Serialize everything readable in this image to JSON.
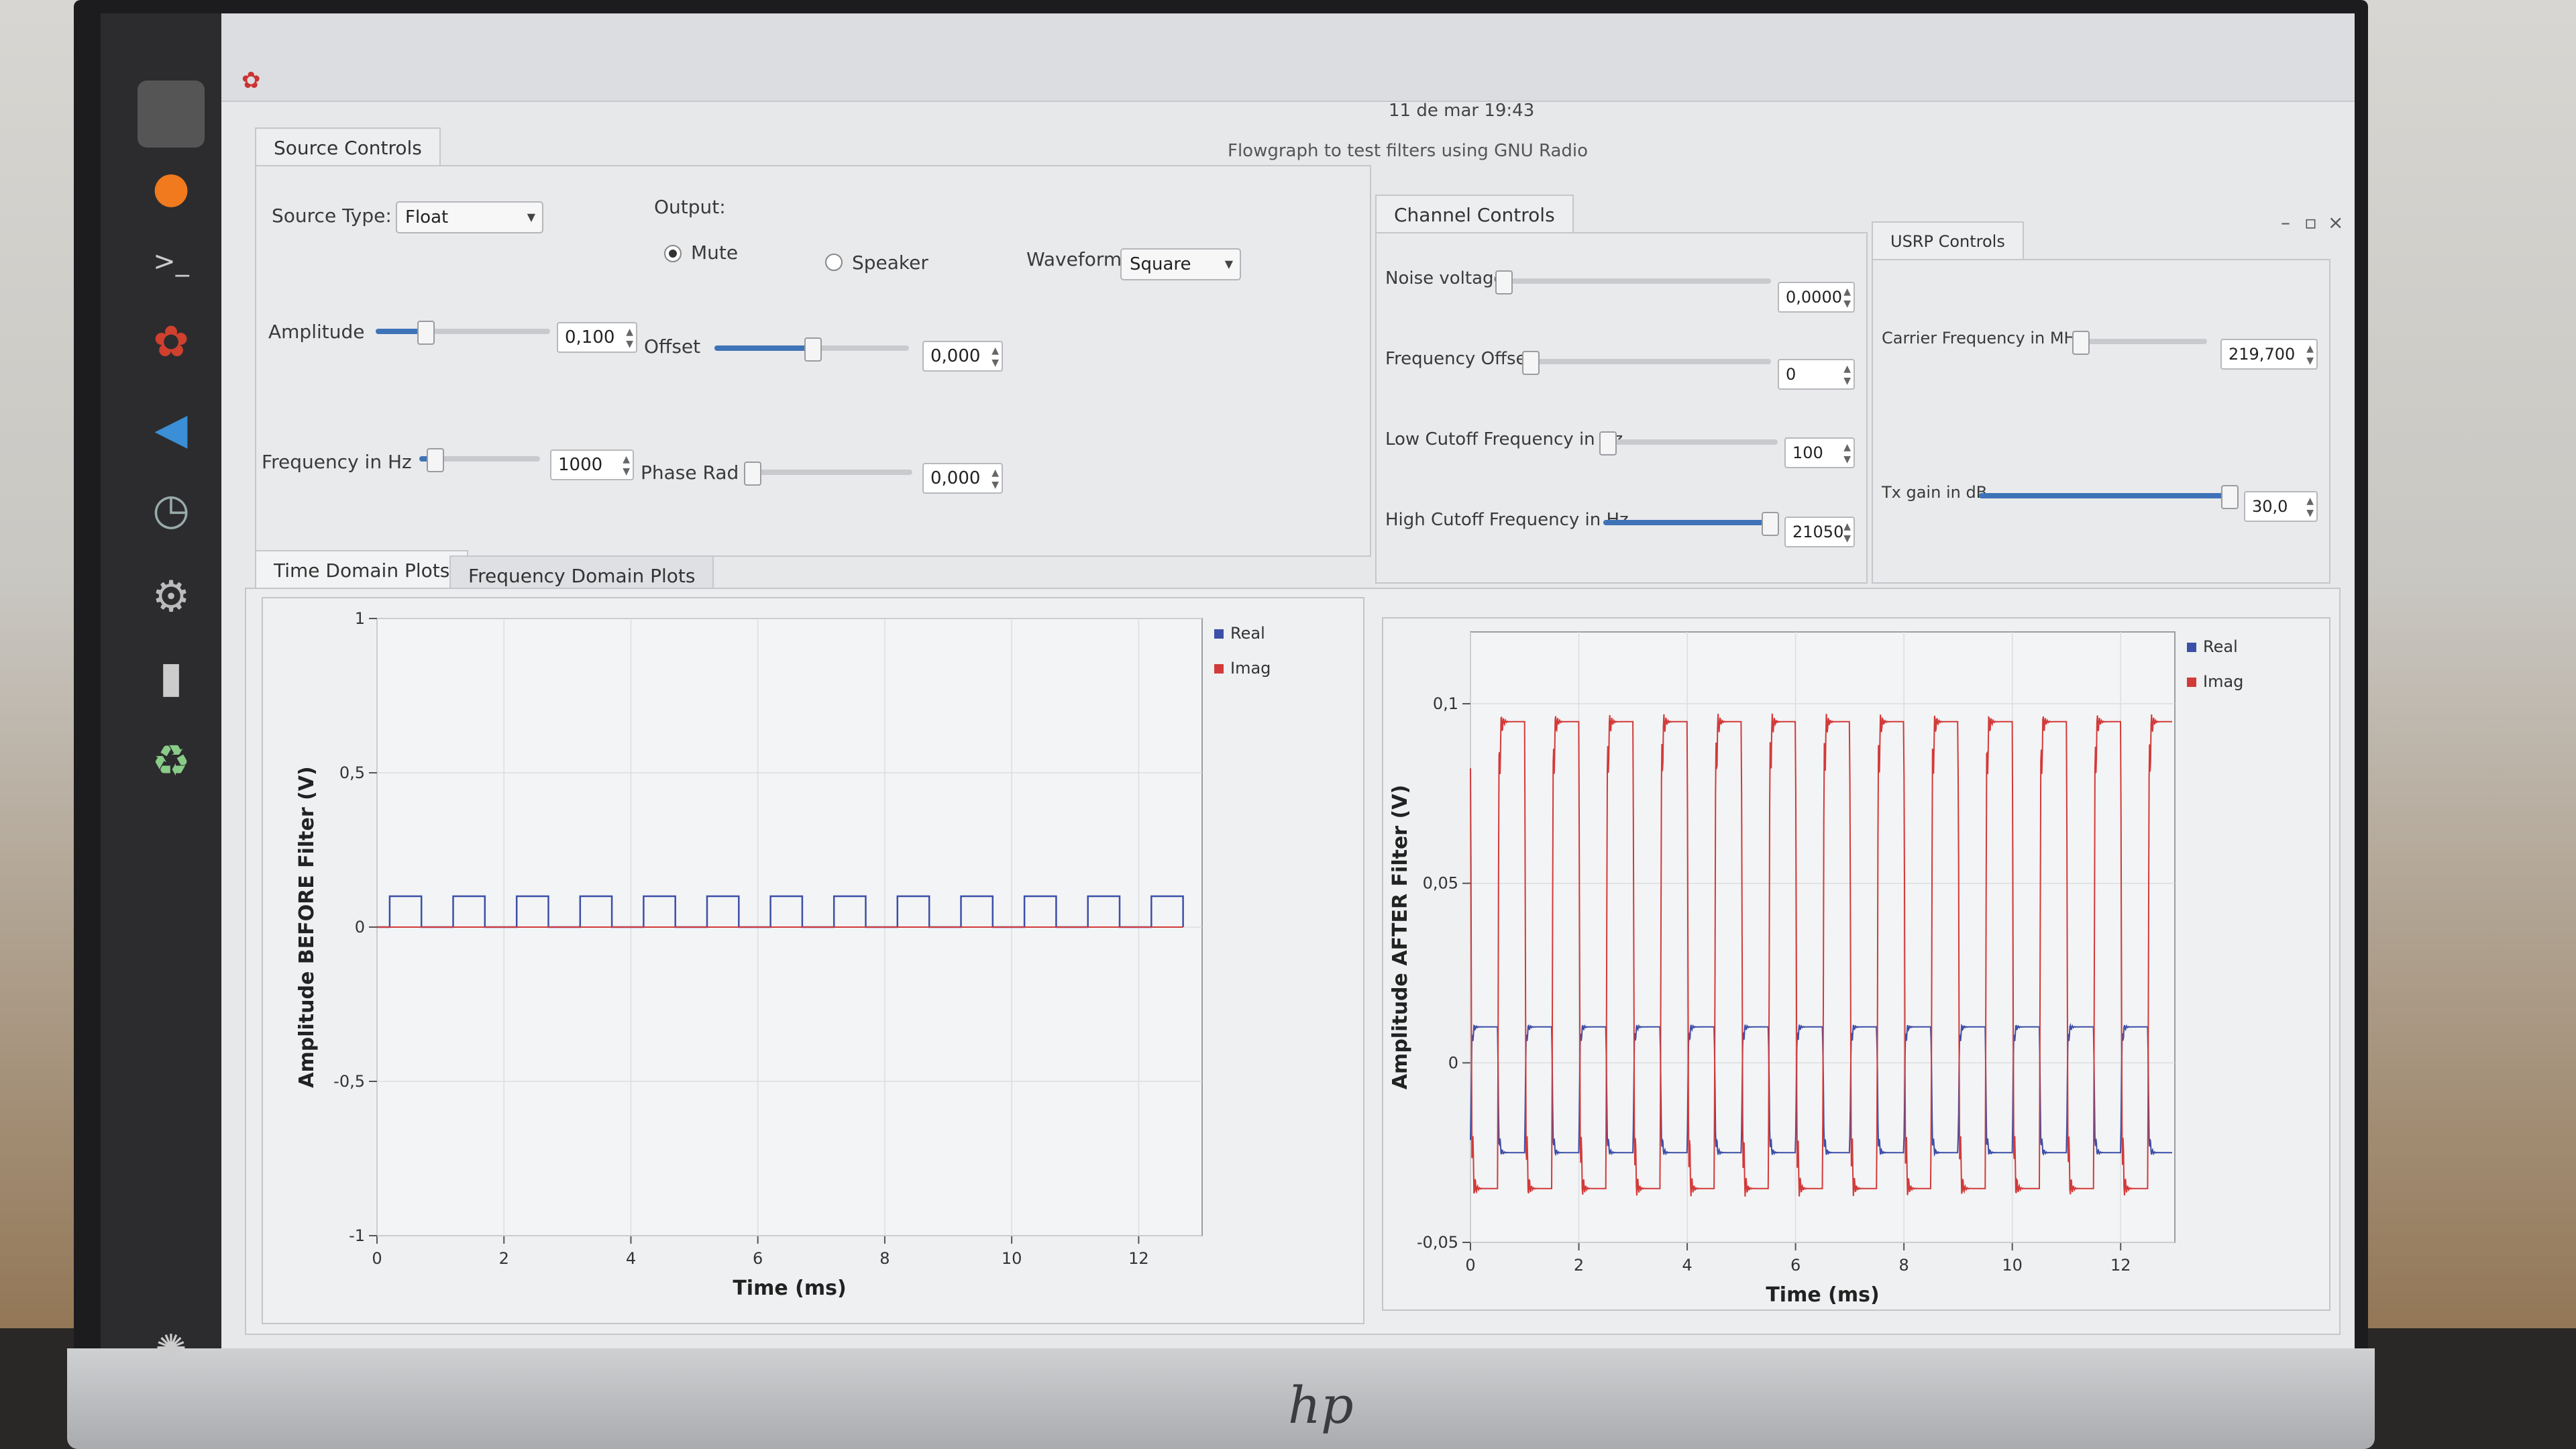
{
  "window": {
    "clock": "11 de mar 19:43",
    "title": "Flowgraph to test filters using GNU Radio",
    "minimize": "–",
    "maximize": "▫",
    "close": "×"
  },
  "source_controls": {
    "tab": "Source Controls",
    "source_type_label": "Source Type:",
    "source_type_value": "Float",
    "output_label": "Output:",
    "mute_label": "Mute",
    "speaker_label": "Speaker",
    "output_selected": "Mute",
    "waveform_label": "Waveform:",
    "waveform_value": "Square",
    "amplitude_label": "Amplitude",
    "amplitude_value": "0,100",
    "amplitude_level": 0.28,
    "offset_label": "Offset",
    "offset_value": "0,000",
    "offset_level": 0.5,
    "frequency_label": "Frequency in Hz",
    "frequency_value": "1000",
    "frequency_level": 0.12,
    "phase_label": "Phase Rad",
    "phase_value": "0,000",
    "phase_level": 0.0
  },
  "channel_controls": {
    "tab": "Channel Controls",
    "noise_label": "Noise voltage",
    "noise_value": "0,0000",
    "noise_level": 0.0,
    "freq_offset_label": "Frequency Offset",
    "freq_offset_value": "0",
    "freq_offset_level": 0.0,
    "low_cutoff_label": "Low Cutoff Frequency in Hz",
    "low_cutoff_value": "100",
    "low_cutoff_level": 0.02,
    "high_cutoff_label": "High Cutoff Frequency in Hz",
    "high_cutoff_value": "21050",
    "high_cutoff_level": 0.95
  },
  "usrp_controls": {
    "tab": "USRP Controls",
    "carrier_label": "Carrier Frequency in MHz",
    "carrier_value": "219,700",
    "carrier_level": 0.05,
    "gain_label": "Tx gain in dB",
    "gain_value": "30,0",
    "gain_level": 0.98
  },
  "plot_tabs": {
    "time_domain": "Time Domain Plots",
    "frequency_domain": "Frequency Domain Plots",
    "active": "Time Domain Plots"
  },
  "colors": {
    "real": "#3c4fa8",
    "imag": "#d23a3a",
    "accent": "#3f73b8"
  },
  "chart_data": [
    {
      "type": "line",
      "ylabel": "Amplitude BEFORE Filter (V)",
      "xlabel": "Time (ms)",
      "xlim": [
        0,
        13
      ],
      "ylim": [
        -1,
        1
      ],
      "xticks": [
        0,
        2,
        4,
        6,
        8,
        10,
        12
      ],
      "yticks": [
        {
          "v": 1,
          "t": "1"
        },
        {
          "v": 0.5,
          "t": "0,5"
        },
        {
          "v": 0,
          "t": "0"
        },
        {
          "v": -0.5,
          "t": "-0,5"
        },
        {
          "v": -1,
          "t": "-1"
        }
      ],
      "legend": "top-right",
      "series": [
        {
          "name": "Real",
          "kind": "square",
          "period": 1.0,
          "low": 0,
          "high": 0.1,
          "duty": 0.5,
          "start": 0.2
        },
        {
          "name": "Imag",
          "kind": "constant",
          "value": 0
        }
      ]
    },
    {
      "type": "line",
      "ylabel": "Amplitude AFTER Filter (V)",
      "xlabel": "Time (ms)",
      "xlim": [
        0,
        13
      ],
      "ylim": [
        -0.05,
        0.12
      ],
      "xticks": [
        0,
        2,
        4,
        6,
        8,
        10,
        12
      ],
      "yticks": [
        {
          "v": 0.1,
          "t": "0,1"
        },
        {
          "v": 0.05,
          "t": "0,05"
        },
        {
          "v": 0,
          "t": "0"
        },
        {
          "v": -0.05,
          "t": "-0,05"
        }
      ],
      "legend": "top-right",
      "series": [
        {
          "name": "Real",
          "kind": "filtered-square",
          "period": 1.0,
          "high": 0.01,
          "low": -0.025
        },
        {
          "name": "Imag",
          "kind": "filtered-square",
          "period": 1.0,
          "high": 0.095,
          "low": -0.035,
          "phase": 0.5
        }
      ]
    }
  ]
}
